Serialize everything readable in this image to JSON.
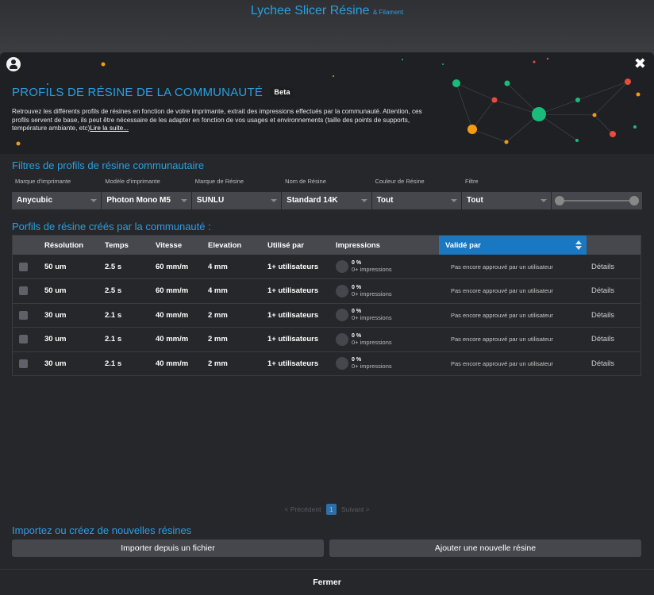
{
  "app": {
    "title": "Lychee Slicer Résine",
    "subtitle": "& Filament"
  },
  "hero": {
    "title": "PROFILS DE RÉSINE DE LA COMMUNAUTÉ",
    "badge": "Beta",
    "description": "Retrouvez les différents profils de résines en fonction de votre imprimante, extrait des impressions effectués par la communauté. Attention, ces profils servent de base, ils peut être nécessaire de les adapter en fonction de vos usages et environnements (taille des points de supports, température ambiante, etc)",
    "read_more": "Lire la suite...",
    "close": "✖"
  },
  "filters": {
    "title": "Filtres de profils de résine communautaire",
    "fields": [
      {
        "label": "Marque d'imprimante",
        "value": "Anycubic"
      },
      {
        "label": "Modèle d'imprimante",
        "value": "Photon Mono M5"
      },
      {
        "label": "Marque de Résine",
        "value": "SUNLU"
      },
      {
        "label": "Nom de Résine",
        "value": "Standard 14K"
      },
      {
        "label": "Couleur de Résine",
        "value": "Tout"
      },
      {
        "label": "Filtre",
        "value": "Tout"
      }
    ],
    "range": {
      "min": 0,
      "max": 1
    }
  },
  "table": {
    "title": "Porfils de résine créés par la communauté :",
    "columns": [
      "Résolution",
      "Temps",
      "Vitesse",
      "Elevation",
      "Utilisé par",
      "Impressions",
      "Validé par"
    ],
    "rows": [
      {
        "resolution": "50 um",
        "time": "2.5 s",
        "speed": "60 mm/m",
        "elevation": "4 mm",
        "used_by": "1+ utilisateurs",
        "pct": "0 %",
        "prints": "0+ impressions",
        "validated": "Pas encore approuvé par un utilisateur",
        "details": "Détails"
      },
      {
        "resolution": "50 um",
        "time": "2.5 s",
        "speed": "60 mm/m",
        "elevation": "4 mm",
        "used_by": "1+ utilisateurs",
        "pct": "0 %",
        "prints": "0+ impressions",
        "validated": "Pas encore approuvé par un utilisateur",
        "details": "Détails"
      },
      {
        "resolution": "30 um",
        "time": "2.1 s",
        "speed": "40 mm/m",
        "elevation": "2 mm",
        "used_by": "1+ utilisateurs",
        "pct": "0 %",
        "prints": "0+ impressions",
        "validated": "Pas encore approuvé par un utilisateur",
        "details": "Détails"
      },
      {
        "resolution": "30 um",
        "time": "2.1 s",
        "speed": "40 mm/m",
        "elevation": "2 mm",
        "used_by": "1+ utilisateurs",
        "pct": "0 %",
        "prints": "0+ impressions",
        "validated": "Pas encore approuvé par un utilisateur",
        "details": "Détails"
      },
      {
        "resolution": "30 um",
        "time": "2.1 s",
        "speed": "40 mm/m",
        "elevation": "2 mm",
        "used_by": "1+ utilisateurs",
        "pct": "0 %",
        "prints": "0+ impressions",
        "validated": "Pas encore approuvé par un utilisateur",
        "details": "Détails"
      }
    ]
  },
  "pagination": {
    "prev": "< Précédent",
    "page": "1",
    "next": "Suivant >"
  },
  "import": {
    "title": "Importez ou créez de nouvelles résines",
    "import_button": "Importer depuis un fichier",
    "add_button": "Ajouter une nouvelle résine"
  },
  "footer": {
    "close_button": "Fermer"
  },
  "colors": {
    "accent": "#2a9fe0",
    "sorted_header": "#1a78c2",
    "node_green": "#1abc7b",
    "node_red": "#e74c3c",
    "node_orange": "#f39c12"
  }
}
